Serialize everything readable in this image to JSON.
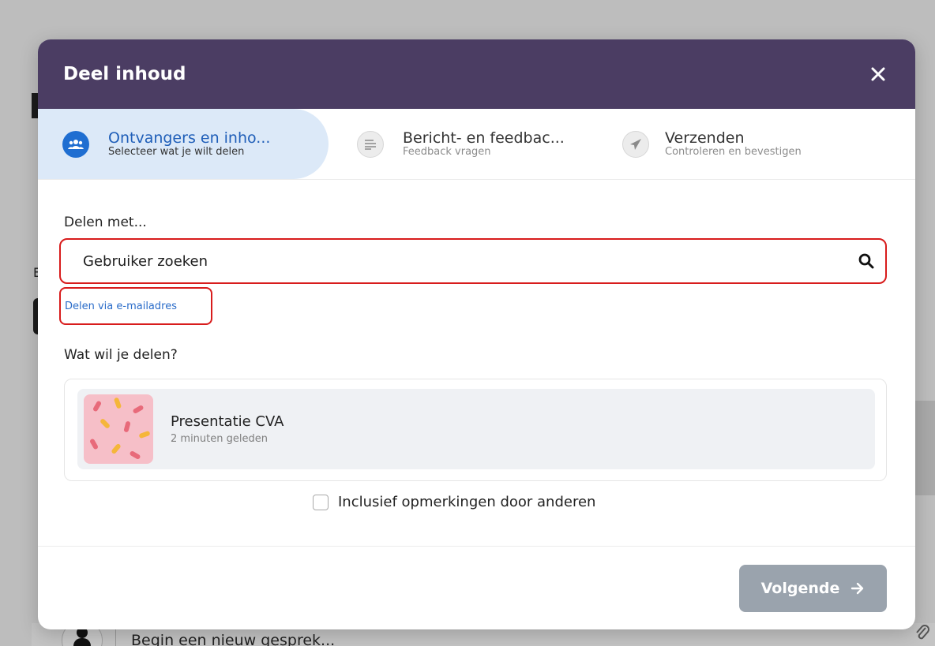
{
  "background": {
    "partial_letter": "E",
    "new_conversation_placeholder": "Begin een nieuw gesprek..."
  },
  "modal": {
    "title": "Deel inhoud",
    "close_icon": "close-icon",
    "steps": [
      {
        "title": "Ontvangers en inho...",
        "subtitle": "Selecteer wat je wilt delen",
        "icon": "people-icon",
        "active": true
      },
      {
        "title": "Bericht- en feedbac...",
        "subtitle": "Feedback vragen",
        "icon": "text-lines-icon",
        "active": false
      },
      {
        "title": "Verzenden",
        "subtitle": "Controleren en bevestigen",
        "icon": "paper-plane-icon",
        "active": false
      }
    ],
    "share_with_label": "Delen met...",
    "search": {
      "placeholder": "Gebruiker zoeken",
      "value": "",
      "icon": "search-icon"
    },
    "share_via_email_link": "Delen via e-mailadres",
    "what_to_share_label": "Wat wil je delen?",
    "content_item": {
      "title": "Presentatie CVA",
      "time": "2 minuten geleden"
    },
    "include_comments": {
      "label": "Inclusief opmerkingen door anderen",
      "checked": false
    },
    "next_button": {
      "label": "Volgende",
      "icon": "arrow-right-icon"
    }
  },
  "colors": {
    "header": "#4b3d63",
    "active_step_bg": "#dce9f8",
    "active_step_text": "#1f5eb8",
    "highlight_border": "#d81c1c",
    "link": "#2a6cc9",
    "disabled_button": "#9aa3ad"
  }
}
